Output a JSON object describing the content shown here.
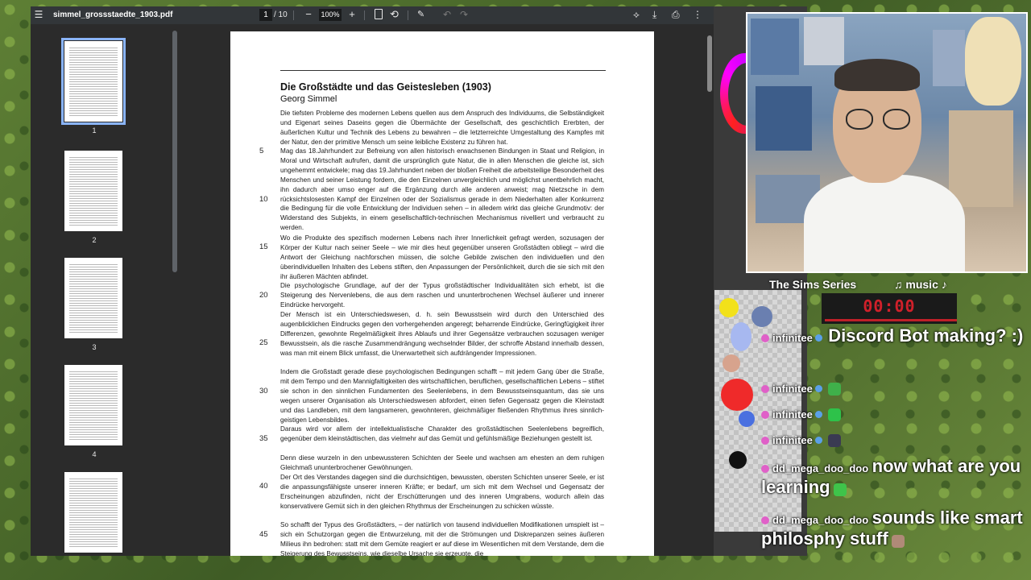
{
  "viewer": {
    "file_name": "simmel_grossstaedte_1903.pdf",
    "current_page": "1",
    "page_total": "/ 10",
    "zoom": "100%",
    "zoom_out": "−",
    "zoom_in": "+",
    "menu_icon": "☰",
    "rotate_icon": "⟲",
    "draw_icon": "✎",
    "undo_icon": "↶",
    "redo_icon": "↷",
    "annotate_icon": "⟡",
    "download_icon": "⤓",
    "print_icon": "⎙",
    "more_icon": "⋮"
  },
  "thumbnails": [
    {
      "label": "1"
    },
    {
      "label": "2"
    },
    {
      "label": "3"
    },
    {
      "label": "4"
    }
  ],
  "paper": {
    "title": "Die Großstädte und das Geistesleben (1903)",
    "author": "Georg Simmel",
    "paragraphs": [
      "Die tiefsten Probleme des modernen Lebens quellen aus dem Anspruch des Individuums, die Selbständigkeit und Eigenart seines Daseins gegen die Übermächte der Gesellschaft, des geschichtlich Ererbten, der äußerlichen Kultur und Technik des Lebens zu bewahren – die letzterreichte Umgestaltung des Kampfes mit der Natur, den der primitive Mensch um seine leibliche Existenz zu führen hat.",
      "Mag das 18.Jahrhundert zur Befreiung von allen historisch erwachsenen Bindungen in Staat und Religion, in Moral und Wirtschaft aufrufen, damit die ursprünglich gute Natur, die in allen Menschen die gleiche ist, sich ungehemmt entwickele; mag das 19.Jahrhundert neben der bloßen Freiheit die arbeitsteilige Besonderheit des Menschen und seiner Leistung fordern, die den Einzelnen unvergleichlich und möglichst unentbehrlich macht, ihn dadurch aber umso enger auf die Ergänzung durch alle anderen anweist; mag Nietzsche in dem rücksichtslosesten Kampf der Einzelnen oder der Sozialismus gerade in dem Niederhalten aller Konkurrenz die Bedingung für die volle Entwicklung der Individuen sehen – in alledem wirkt das gleiche Grundmotiv: der Widerstand des Subjekts, in einem gesellschaftlich-technischen Mechanismus nivelliert und verbraucht zu werden.",
      "Wo die Produkte des spezifisch modernen Lebens nach ihrer Innerlichkeit gefragt werden, sozusagen der Körper der Kultur nach seiner Seele – wie mir dies heut gegenüber unseren Großstädten obliegt – wird die Antwort der Gleichung nachforschen müssen, die solche Gebilde zwischen den individuellen und den überindividuellen Inhalten des Lebens stiften, den Anpassungen der Persönlichkeit, durch die sie sich mit den ihr äußeren Mächten abfindet.",
      "Die psychologische Grundlage, auf der der Typus großstädtischer Individualitäten sich erhebt, ist die Steigerung des Nervenlebens, die aus dem raschen und ununterbrochenen Wechsel äußerer und innerer Eindrücke hervorgeht.",
      "Der Mensch ist ein Unterschiedswesen, d. h. sein Bewusstsein wird durch den Unterschied des augenblicklichen Eindrucks gegen den vorhergehenden angeregt; beharrende Eindrücke, Geringfügigkeit ihrer Differenzen, gewohnte Regelmäßigkeit ihres Ablaufs und ihrer Gegensätze verbrauchen sozusagen weniger Bewusstsein, als die rasche Zusammendrängung wechselnder Bilder, der schroffe Abstand innerhalb dessen, was man mit einem Blick umfasst, die Unerwartetheit sich aufdrängender Impressionen.",
      "Indem die Großstadt gerade diese psychologischen Bedingungen schafft – mit jedem Gang über die Straße, mit dem Tempo und den Mannigfaltigkeiten des wirtschaftlichen, beruflichen, gesellschaftlichen Lebens – stiftet sie schon in den sinnlichen Fundamenten des Seelenlebens, in dem Bewusstseinsquantum, das sie uns wegen unserer Organisation als Unterschiedswesen abfordert, einen tiefen Gegensatz gegen die Kleinstadt und das Landleben, mit dem langsameren, gewohnteren, gleichmäßiger fließenden Rhythmus ihres sinnlich-geistigen Lebensbildes.",
      "Daraus wird vor allem der intellektualistische Charakter des großstädtischen Seelenlebens begreiflich, gegenüber dem kleinstädtischen, das vielmehr auf das Gemüt und gefühlsmäßige Beziehungen gestellt ist.",
      "Denn diese wurzeln in den unbewussteren Schichten der Seele und wachsen am ehesten an dem ruhigen Gleichmaß ununterbrochener Gewöhnungen.",
      "Der Ort des Verstandes dagegen sind die durchsichtigen, bewussten, obersten Schichten unserer Seele, er ist die anpassungsfähigste unserer inneren Kräfte; er bedarf, um sich mit dem Wechsel und Gegensatz der Erscheinungen abzufinden, nicht der Erschütterungen und des inneren Umgrabens, wodurch allein das konservativere Gemüt sich in den gleichen Rhythmus der Erscheinungen zu schicken wüsste.",
      "So schafft der Typus des Großstädters, – der natürlich von tausend individuellen Modifikationen umspielt ist – sich ein Schutzorgan gegen die Entwurzelung, mit der die Strömungen und Diskrepanzen seines äußeren Milieus ihn bedrohen: statt mit dem Gemüte reagiert er auf diese im Wesentlichen mit dem Verstande, dem die Steigerung des Bewusstseins, wie dieselbe Ursache sie erzeugte, die"
    ],
    "line_numbers": [
      "5",
      "10",
      "15",
      "20",
      "25",
      "30",
      "35",
      "40",
      "45"
    ]
  },
  "stream": {
    "series_label": "The Sims Series",
    "music_label": "♫ music ♪",
    "timer": "00:00"
  },
  "chat": [
    {
      "user": "infinitee",
      "message": "Discord Bot making? :)"
    },
    {
      "user": "infinitee",
      "message": ""
    },
    {
      "user": "infinitee",
      "message": ""
    },
    {
      "user": "infinitee",
      "message": ""
    },
    {
      "user": "dd_mega_doo_doo",
      "message": "now what are you learning"
    },
    {
      "user": "dd_mega_doo_doo",
      "message": "sounds like smart philosphy stuff"
    }
  ],
  "colors": {
    "accent": "#8ab4f8",
    "timer_red": "#d0202a",
    "viewer_bg": "#2b2b2b"
  }
}
